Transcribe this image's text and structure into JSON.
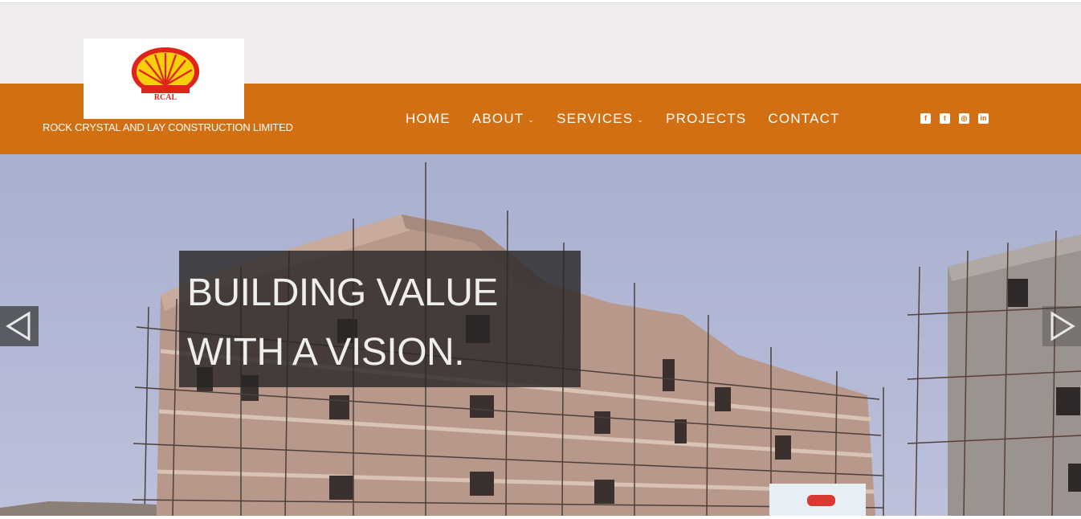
{
  "brand": {
    "logo_text": "RCAL",
    "name": "ROCK CRYSTAL AND LAY CONSTRUCTION LIMITED"
  },
  "nav": {
    "items": [
      {
        "label": "HOME",
        "dropdown": false
      },
      {
        "label": "ABOUT",
        "dropdown": true
      },
      {
        "label": "SERVICES",
        "dropdown": true
      },
      {
        "label": "PROJECTS",
        "dropdown": false
      },
      {
        "label": "CONTACT",
        "dropdown": false
      }
    ],
    "caret": "⌄"
  },
  "social": [
    {
      "icon": "facebook-icon",
      "glyph": "f"
    },
    {
      "icon": "twitter-icon",
      "glyph": "t"
    },
    {
      "icon": "instagram-icon",
      "glyph": "◎"
    },
    {
      "icon": "linkedin-icon",
      "glyph": "in"
    }
  ],
  "hero": {
    "caption_line1": "BUILDING VALUE",
    "caption_line2": "WITH A VISION."
  },
  "colors": {
    "nav_bg": "#d16f12",
    "top_strip": "#efeceb",
    "caption_bg": "#282626"
  }
}
